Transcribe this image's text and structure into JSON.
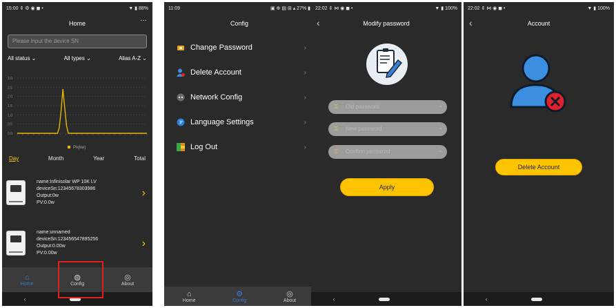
{
  "colors": {
    "accent": "#ffc400",
    "active_tab": "#3a7bd5",
    "chart_line": "#e6b800",
    "highlight_box": "#e02020",
    "danger": "#e0202a"
  },
  "screen1": {
    "status_time": "15:00",
    "status_icons": "⇕ ⚙ ◉ ◼ •",
    "status_battery": "▼ ▮ 88%",
    "title": "Home",
    "more": "···",
    "search_placeholder": "Please input the device SN",
    "filters": [
      "All status ⌄",
      "All types ⌄",
      "Alias A-Z ⌄"
    ],
    "chart_y_ticks": [
      "3.0",
      "2.5",
      "2.0",
      "1.5",
      "1.0",
      "0.5",
      "0.0"
    ],
    "legend": "Pv(kw)",
    "periods": [
      "Day",
      "Month",
      "Year",
      "Total"
    ],
    "devices": [
      {
        "name": "name:Infinisolar WP 10K LV",
        "sn": "deviceSn:12345678303986",
        "output": "Output:0w",
        "pv": "PV:0.0w"
      },
      {
        "name": "name:unnamed",
        "sn": "deviceSn:123456547895256",
        "output": "Output:0.00w",
        "pv": "PV:0.00w"
      }
    ],
    "tabs": [
      {
        "label": "Home",
        "icon": "home-icon"
      },
      {
        "label": "Config",
        "icon": "globe-icon"
      },
      {
        "label": "About",
        "icon": "info-icon"
      }
    ]
  },
  "chart_data": {
    "type": "line",
    "y_ticks": [
      "3.0",
      "2.5",
      "2.0",
      "1.5",
      "1.0",
      "0.5",
      "0.0"
    ],
    "ylim": [
      0,
      3.0
    ],
    "legend": [
      "Pv(kw)"
    ],
    "grid": true,
    "series": [
      {
        "name": "Pv(kw)",
        "values": [
          0,
          0,
          0,
          0,
          0,
          0,
          0,
          0,
          0,
          0,
          0,
          0,
          0,
          0,
          0,
          0,
          0,
          0,
          0,
          0,
          0,
          0,
          0,
          0.3,
          1.2,
          2.4,
          1.4,
          0.4,
          0,
          0,
          0,
          0,
          0,
          0,
          0,
          0,
          0,
          0,
          0,
          0,
          0,
          0,
          0,
          0,
          0,
          0,
          0,
          0,
          0,
          0,
          0,
          0,
          0,
          0,
          0,
          0,
          0,
          0,
          0,
          0,
          0,
          0,
          0,
          0,
          0,
          0,
          0,
          0,
          0,
          0,
          0,
          0
        ]
      }
    ]
  },
  "screen2": {
    "status_time": "11:09",
    "status_icons": "▣ ⊕ ▤ ⊞ ▴ 27% ▮",
    "title": "Config",
    "menu": [
      {
        "label": "Change Password",
        "icon": "key-icon"
      },
      {
        "label": "Delete Account",
        "icon": "user-delete-icon"
      },
      {
        "label": "Network Config",
        "icon": "network-icon"
      },
      {
        "label": "Language Settings",
        "icon": "globe-icon"
      },
      {
        "label": "Log Out",
        "icon": "logout-icon"
      }
    ],
    "tabs": [
      "Home",
      "Config",
      "About"
    ]
  },
  "screen3": {
    "status_time": "22:02",
    "status_icons": "⇕ ⋈ ◉ ◼ •",
    "status_battery": "▼ ▮ 100%",
    "title": "Modify password",
    "fields": [
      "Old password",
      "New password",
      "Confirm password"
    ],
    "apply": "Apply"
  },
  "screen4": {
    "status_time": "22:02",
    "status_icons": "⇕ ⋈ ◉ ◼ •",
    "status_battery": "▼ ▮ 100%",
    "title": "Account",
    "delete": "Delete Account"
  }
}
